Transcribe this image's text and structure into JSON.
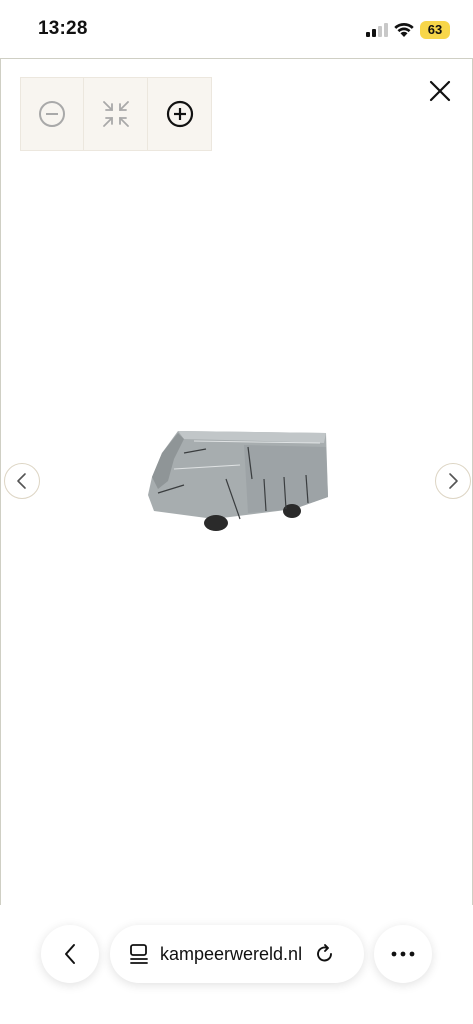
{
  "status": {
    "time": "13:28",
    "battery": "63",
    "battery_color": "#f7d64a"
  },
  "viewer": {
    "toolbar": {
      "zoom_out_icon": "minus-circle-icon",
      "fit_icon": "collapse-arrows-icon",
      "zoom_in_icon": "plus-circle-icon"
    },
    "close_icon": "close-icon",
    "prev_icon": "chevron-left-icon",
    "next_icon": "chevron-right-icon",
    "image": "covered-camper-van"
  },
  "browser": {
    "url": "kampeerwereld.nl",
    "back_icon": "chevron-left-icon",
    "reader_icon": "reader-icon",
    "reload_icon": "reload-icon",
    "more_icon": "more-icon"
  },
  "colors": {
    "toolbar_bg": "#f8f5f0",
    "frame_border": "#cfcfc4",
    "arrow_border": "#ddd5c4"
  }
}
